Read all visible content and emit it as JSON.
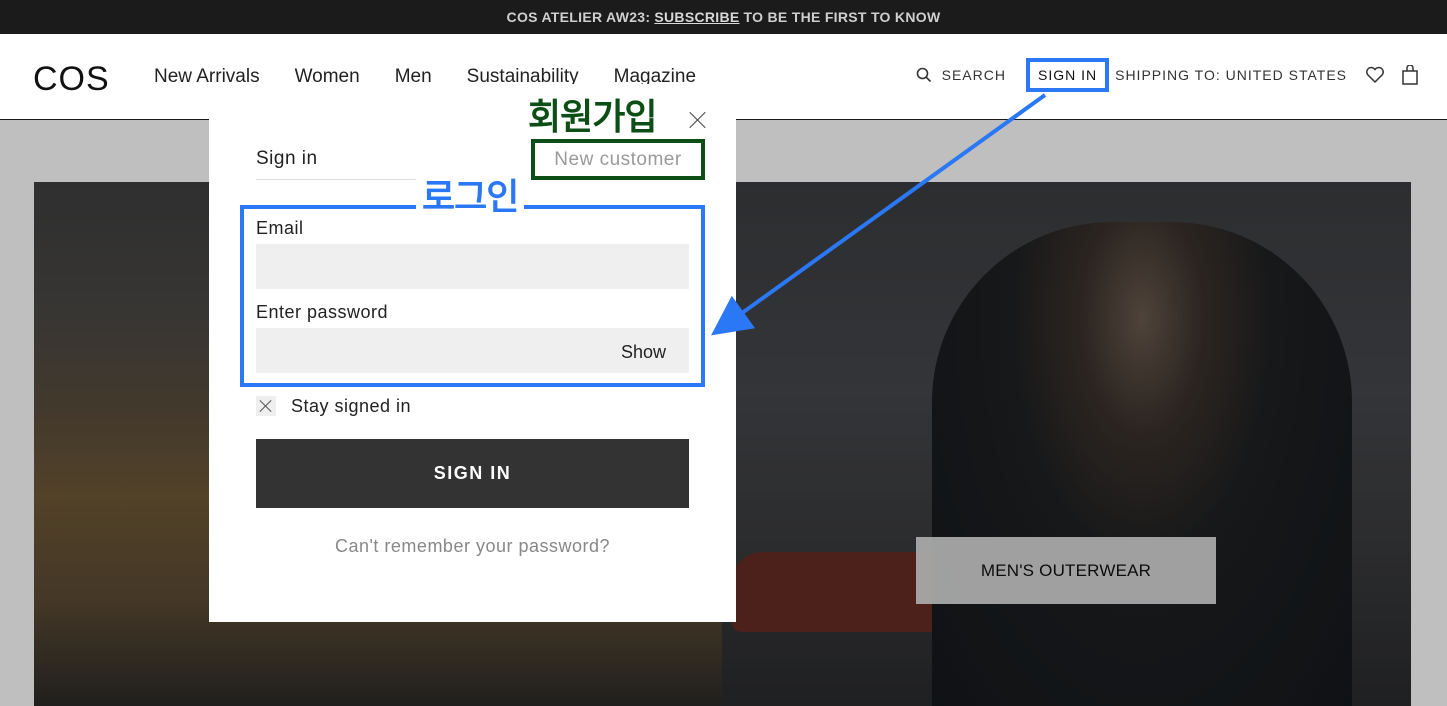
{
  "promo": {
    "text_before": "COS ATELIER AW23:",
    "link": "SUBSCRIBE",
    "text_after": "TO BE THE FIRST TO KNOW"
  },
  "header": {
    "logo": "COS",
    "nav": [
      "New Arrivals",
      "Women",
      "Men",
      "Sustainability",
      "Magazine"
    ],
    "search_label": "SEARCH",
    "signin_label": "SIGN IN",
    "shipping_label": "SHIPPING TO: UNITED STATES"
  },
  "hero": {
    "cta_label": "MEN'S OUTERWEAR"
  },
  "modal": {
    "tab_signin": "Sign in",
    "tab_new_customer": "New customer",
    "email_label": "Email",
    "email_value": "",
    "password_label": "Enter password",
    "password_value": "",
    "show_label": "Show",
    "stay_signed_in": "Stay signed in",
    "submit_label": "SIGN IN",
    "forgot_label": "Can't remember your password?"
  },
  "annotations": {
    "signup_korean": "회원가입",
    "login_korean": "로그인",
    "signup_color": "#0d4e17",
    "login_color": "#2a78f5"
  },
  "icons": {
    "search": "search-icon",
    "wishlist": "heart-icon",
    "bag": "bag-icon",
    "close": "close-icon"
  }
}
